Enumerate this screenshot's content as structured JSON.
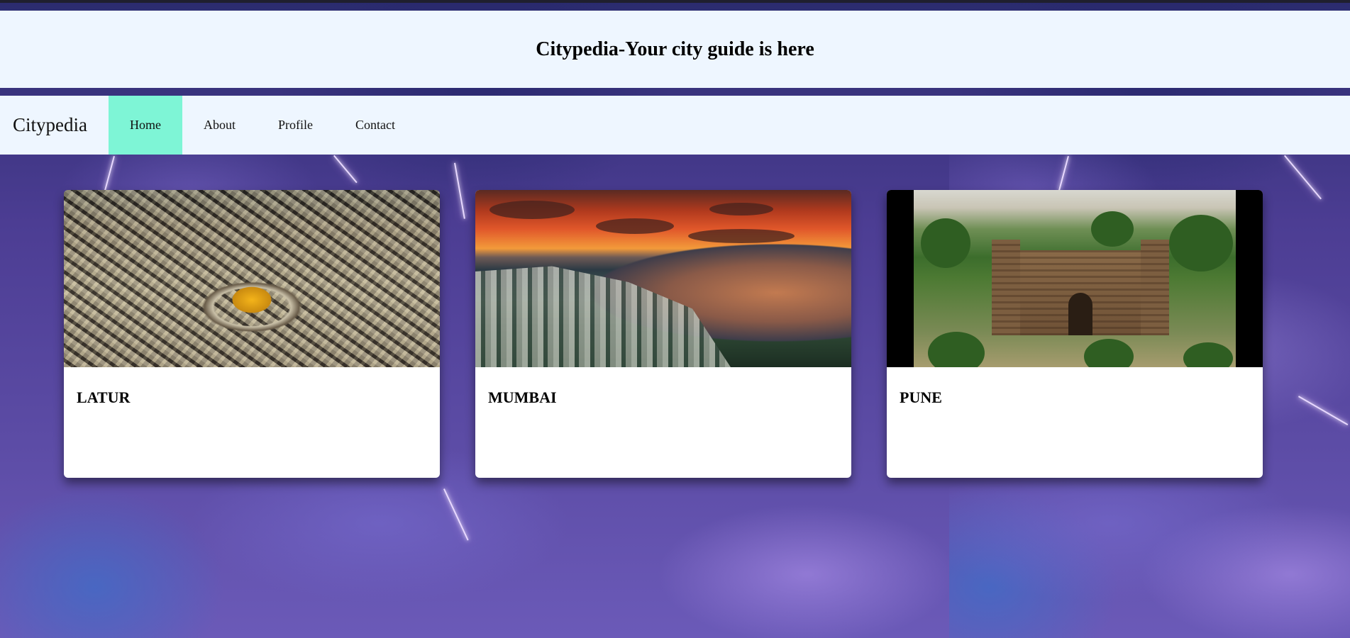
{
  "banner": {
    "title": "Citypedia-Your city guide is here"
  },
  "navbar": {
    "brand": "Citypedia",
    "items": [
      {
        "label": "Home",
        "active": true
      },
      {
        "label": "About",
        "active": false
      },
      {
        "label": "Profile",
        "active": false
      },
      {
        "label": "Contact",
        "active": false
      }
    ]
  },
  "cards": [
    {
      "title": "LATUR",
      "image": "latur-aerial-photo"
    },
    {
      "title": "MUMBAI",
      "image": "mumbai-sunset-bay-photo"
    },
    {
      "title": "PUNE",
      "image": "pune-fort-photo"
    }
  ],
  "colors": {
    "header_bg": "#eef6ff",
    "active_nav": "#7ef5d6",
    "page_bg": "#4a3a8a"
  }
}
